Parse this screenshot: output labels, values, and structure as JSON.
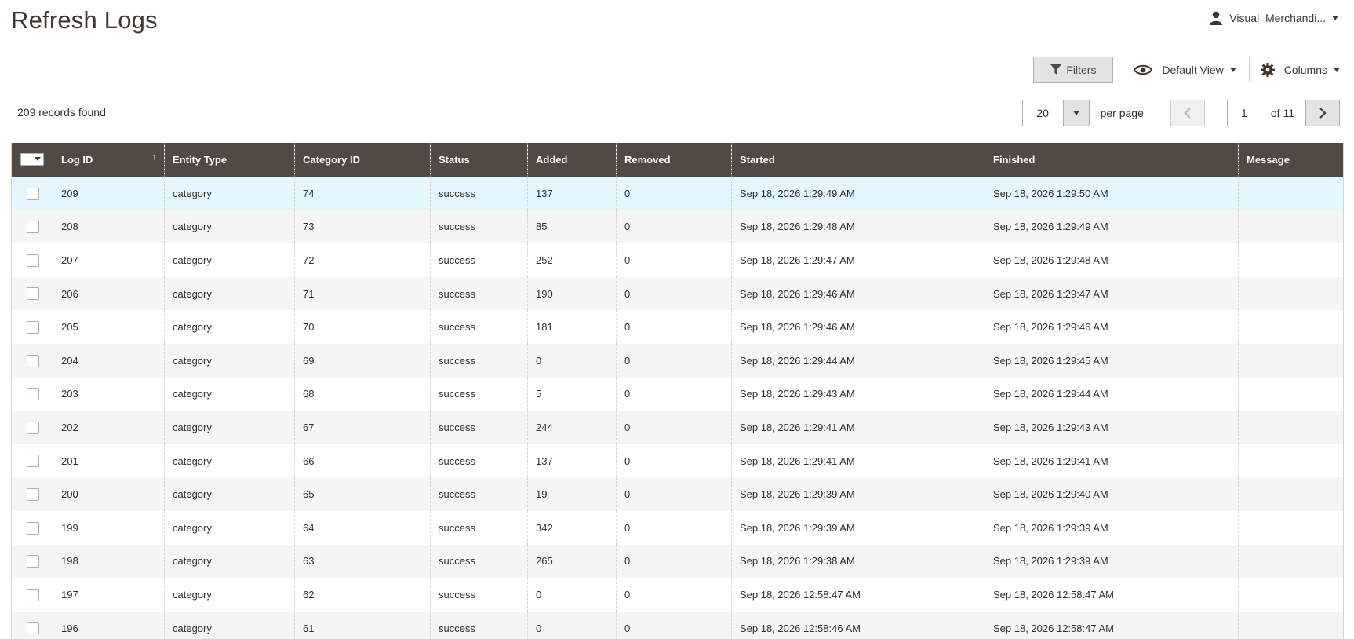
{
  "page": {
    "title": "Refresh Logs"
  },
  "user": {
    "name": "Visual_Merchandi..."
  },
  "toolbar": {
    "filters_label": "Filters",
    "view_label": "Default View",
    "columns_label": "Columns"
  },
  "records_label": "209 records found",
  "pager": {
    "per_page_value": "20",
    "per_page_label": "per page",
    "current_page": "1",
    "of_pages": "of 11"
  },
  "columns": [
    "Log ID",
    "Entity Type",
    "Category ID",
    "Status",
    "Added",
    "Removed",
    "Started",
    "Finished",
    "Message"
  ],
  "sort": {
    "column": "Log ID",
    "direction": "asc"
  },
  "rows": [
    {
      "log_id": "209",
      "entity_type": "category",
      "category_id": "74",
      "status": "success",
      "added": "137",
      "removed": "0",
      "started": "Sep 18, 2026 1:29:49 AM",
      "finished": "Sep 18, 2026 1:29:50 AM",
      "message": ""
    },
    {
      "log_id": "208",
      "entity_type": "category",
      "category_id": "73",
      "status": "success",
      "added": "85",
      "removed": "0",
      "started": "Sep 18, 2026 1:29:48 AM",
      "finished": "Sep 18, 2026 1:29:49 AM",
      "message": ""
    },
    {
      "log_id": "207",
      "entity_type": "category",
      "category_id": "72",
      "status": "success",
      "added": "252",
      "removed": "0",
      "started": "Sep 18, 2026 1:29:47 AM",
      "finished": "Sep 18, 2026 1:29:48 AM",
      "message": ""
    },
    {
      "log_id": "206",
      "entity_type": "category",
      "category_id": "71",
      "status": "success",
      "added": "190",
      "removed": "0",
      "started": "Sep 18, 2026 1:29:46 AM",
      "finished": "Sep 18, 2026 1:29:47 AM",
      "message": ""
    },
    {
      "log_id": "205",
      "entity_type": "category",
      "category_id": "70",
      "status": "success",
      "added": "181",
      "removed": "0",
      "started": "Sep 18, 2026 1:29:46 AM",
      "finished": "Sep 18, 2026 1:29:46 AM",
      "message": ""
    },
    {
      "log_id": "204",
      "entity_type": "category",
      "category_id": "69",
      "status": "success",
      "added": "0",
      "removed": "0",
      "started": "Sep 18, 2026 1:29:44 AM",
      "finished": "Sep 18, 2026 1:29:45 AM",
      "message": ""
    },
    {
      "log_id": "203",
      "entity_type": "category",
      "category_id": "68",
      "status": "success",
      "added": "5",
      "removed": "0",
      "started": "Sep 18, 2026 1:29:43 AM",
      "finished": "Sep 18, 2026 1:29:44 AM",
      "message": ""
    },
    {
      "log_id": "202",
      "entity_type": "category",
      "category_id": "67",
      "status": "success",
      "added": "244",
      "removed": "0",
      "started": "Sep 18, 2026 1:29:41 AM",
      "finished": "Sep 18, 2026 1:29:43 AM",
      "message": ""
    },
    {
      "log_id": "201",
      "entity_type": "category",
      "category_id": "66",
      "status": "success",
      "added": "137",
      "removed": "0",
      "started": "Sep 18, 2026 1:29:41 AM",
      "finished": "Sep 18, 2026 1:29:41 AM",
      "message": ""
    },
    {
      "log_id": "200",
      "entity_type": "category",
      "category_id": "65",
      "status": "success",
      "added": "19",
      "removed": "0",
      "started": "Sep 18, 2026 1:29:39 AM",
      "finished": "Sep 18, 2026 1:29:40 AM",
      "message": ""
    },
    {
      "log_id": "199",
      "entity_type": "category",
      "category_id": "64",
      "status": "success",
      "added": "342",
      "removed": "0",
      "started": "Sep 18, 2026 1:29:39 AM",
      "finished": "Sep 18, 2026 1:29:39 AM",
      "message": ""
    },
    {
      "log_id": "198",
      "entity_type": "category",
      "category_id": "63",
      "status": "success",
      "added": "265",
      "removed": "0",
      "started": "Sep 18, 2026 1:29:38 AM",
      "finished": "Sep 18, 2026 1:29:39 AM",
      "message": ""
    },
    {
      "log_id": "197",
      "entity_type": "category",
      "category_id": "62",
      "status": "success",
      "added": "0",
      "removed": "0",
      "started": "Sep 18, 2026 12:58:47 AM",
      "finished": "Sep 18, 2026 12:58:47 AM",
      "message": ""
    },
    {
      "log_id": "196",
      "entity_type": "category",
      "category_id": "61",
      "status": "success",
      "added": "0",
      "removed": "0",
      "started": "Sep 18, 2026 12:58:46 AM",
      "finished": "Sep 18, 2026 12:58:47 AM",
      "message": ""
    }
  ],
  "colors": {
    "header_bg": "#514943",
    "highlight_row": "#e5f7fe",
    "stripe_row": "#f5f5f5",
    "title": "#41362f"
  },
  "icons": {
    "user": "user-icon",
    "filter": "filter-icon",
    "view": "eye-icon",
    "columns": "gear-icon",
    "prev": "chevron-left-icon",
    "next": "chevron-right-icon"
  }
}
